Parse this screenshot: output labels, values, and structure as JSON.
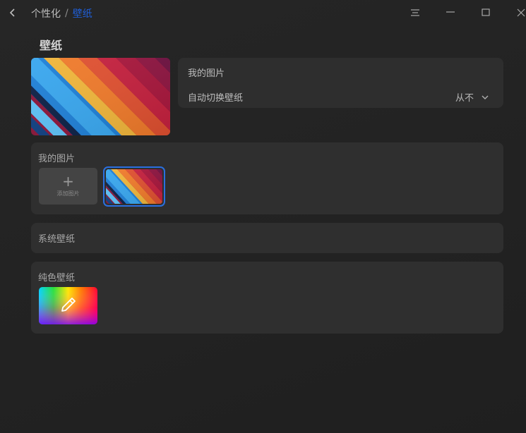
{
  "titlebar": {
    "breadcrumb_parent": "个性化",
    "breadcrumb_separator": "/",
    "breadcrumb_current": "壁纸",
    "back_icon": "chevron-left-icon",
    "menu_icon": "menu-icon",
    "minimize_icon": "minimize-icon",
    "maximize_icon": "maximize-icon",
    "close_icon": "close-icon"
  },
  "page": {
    "title": "壁纸"
  },
  "current": {
    "source_label": "我的图片",
    "auto_switch_label": "自动切换壁纸",
    "auto_switch_value": "从不"
  },
  "my_pictures": {
    "title": "我的图片",
    "add_label": "添加图片"
  },
  "system_wallpapers": {
    "title": "系统壁纸"
  },
  "solid_wallpapers": {
    "title": "纯色壁纸",
    "edit_icon": "pencil-icon"
  },
  "colors": {
    "accent": "#1f5fd8",
    "selection_border": "#2a6fe0",
    "card_bg": "#2f2f2f",
    "panel_bg": "#2e2e2e"
  }
}
